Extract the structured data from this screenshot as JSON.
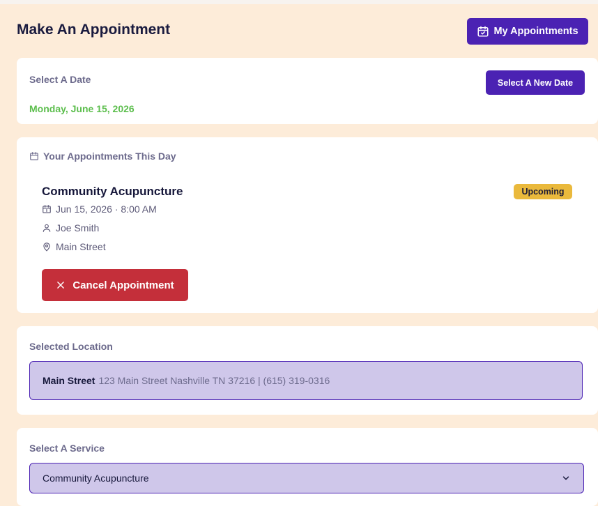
{
  "header": {
    "title": "Make An Appointment",
    "my_appointments_label": "My Appointments"
  },
  "date_section": {
    "label": "Select A Date",
    "select_new_date_label": "Select A New Date",
    "selected_date": "Monday, June 15, 2026"
  },
  "appointments_section": {
    "heading": "Your Appointments This Day",
    "appointment": {
      "name": "Community Acupuncture",
      "status": "Upcoming",
      "datetime": "Jun 15, 2026 · 8:00 AM",
      "practitioner": "Joe Smith",
      "location": "Main Street",
      "cancel_label": "Cancel Appointment"
    }
  },
  "location_section": {
    "label": "Selected Location",
    "location_name": "Main Street",
    "location_details": "123 Main Street Nashville TN 37216 | (615) 319-0316"
  },
  "service_section": {
    "label": "Select A Service",
    "selected_service": "Community Acupuncture"
  },
  "colors": {
    "page_background": "#fdecd9",
    "primary": "#4b22b3",
    "danger": "#c42f3a",
    "date_green": "#5cbe4d",
    "badge_yellow": "#eab93c",
    "field_fill": "#cfc7ea"
  },
  "icons": {
    "my_appointments": "calendar-check-icon",
    "appointments_heading": "calendar-icon",
    "datetime": "calendar-date-icon",
    "practitioner": "user-icon",
    "location": "map-pin-icon",
    "cancel": "close-icon",
    "service_dropdown": "chevron-down-icon"
  }
}
